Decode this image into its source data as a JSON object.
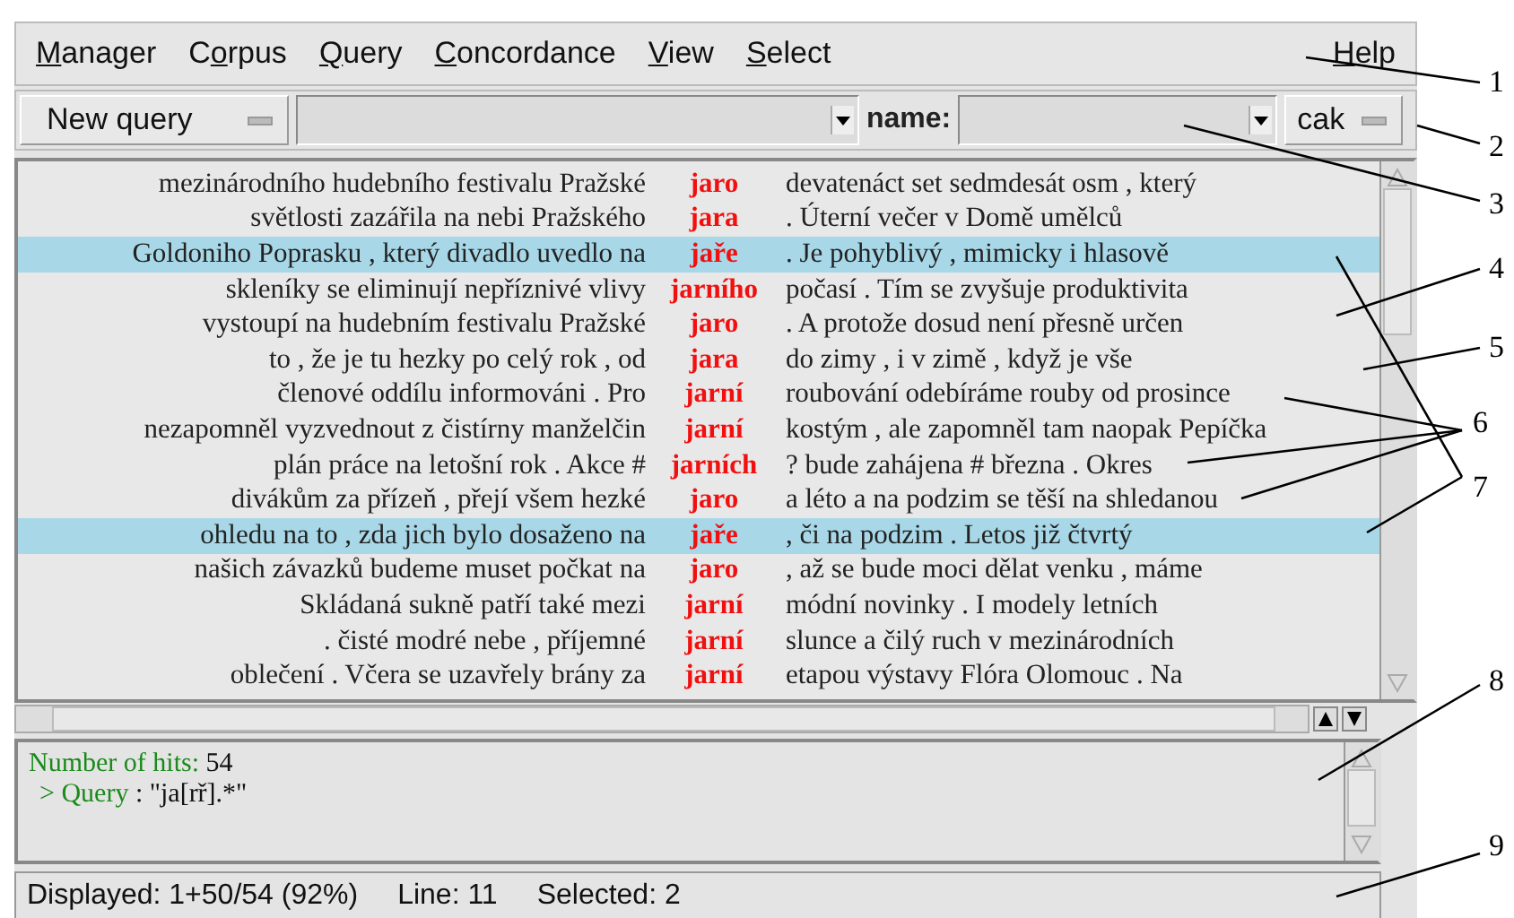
{
  "menu": [
    {
      "key": "M",
      "after": "anager"
    },
    {
      "before": "C",
      "key": "o",
      "after": "rpus"
    },
    {
      "key": "Q",
      "after": "uery"
    },
    {
      "key": "C",
      "after": "oncordance"
    },
    {
      "key": "V",
      "after": "iew"
    },
    {
      "key": "S",
      "after": "elect"
    },
    {
      "key": "H",
      "after": "elp"
    }
  ],
  "toolbar": {
    "query_type": "New query",
    "name_label": "name:",
    "corpus": "cak"
  },
  "rows": [
    {
      "left": "mezinárodního hudebního festivalu Pražské",
      "kwic": "jaro",
      "right": "devatenáct set sedmdesát osm , který",
      "selected": false
    },
    {
      "left": "světlosti zazářila na nebi Pražského",
      "kwic": "jara",
      "right": ".  Úterní večer v Domě umělců",
      "selected": false
    },
    {
      "left": "Goldoniho Poprasku , který divadlo uvedlo na",
      "kwic": "jaře",
      "right": ".  Je pohyblivý , mimicky i hlasově",
      "selected": true
    },
    {
      "left": "skleníky se eliminují nepříznivé vlivy",
      "kwic": "jarního",
      "right": "počasí .  Tím se zvyšuje produktivita",
      "selected": false
    },
    {
      "left": "vystoupí na hudebním festivalu Pražské",
      "kwic": "jaro",
      "right": ".  A protože dosud není přesně určen",
      "selected": false
    },
    {
      "left": "to , že je tu hezky po celý rok , od",
      "kwic": "jara",
      "right": "do zimy , i v zimě , když je vše",
      "selected": false
    },
    {
      "left": "členové oddílu informováni .  Pro",
      "kwic": "jarní",
      "right": "roubování odebíráme rouby od prosince",
      "selected": false
    },
    {
      "left": "nezapomněl vyzvednout z čistírny manželčin",
      "kwic": "jarní",
      "right": "kostým , ale zapomněl tam naopak Pepíčka",
      "selected": false
    },
    {
      "left": "plán práce na letošní rok .  Akce #",
      "kwic": "jarních",
      "right": "? bude zahájena # března .  Okres",
      "selected": false
    },
    {
      "left": "divákům za přízeň , přejí všem hezké",
      "kwic": "jaro",
      "right": "a léto a na podzim se těší na shledanou",
      "selected": false
    },
    {
      "left": "ohledu na to , zda jich bylo dosaženo na",
      "kwic": "jaře",
      "right": ", či na podzim .  Letos již čtvrtý",
      "selected": true
    },
    {
      "left": "našich závazků budeme muset počkat na",
      "kwic": "jaro",
      "right": ", až se bude moci dělat venku , máme",
      "selected": false
    },
    {
      "left": "Skládaná sukně patří také mezi",
      "kwic": "jarní",
      "right": "módní novinky .  I modely letních",
      "selected": false
    },
    {
      "left": ".  čisté modré nebe , příjemné",
      "kwic": "jarní",
      "right": "slunce a čilý ruch v mezinárodních",
      "selected": false
    },
    {
      "left": "oblečení .  Včera se uzavřely brány za",
      "kwic": "jarní",
      "right": "etapou výstavy Flóra Olomouc .  Na",
      "selected": false
    }
  ],
  "info": {
    "hits_label": "Number of hits:",
    "hits": "54",
    "query_label": "> Query",
    "query": ": \"ja[rř].*\""
  },
  "status": {
    "displayed": "Displayed: 1+50/54  (92%)",
    "line": "Line: 11",
    "selected": "Selected: 2"
  },
  "callouts": [
    "1",
    "2",
    "3",
    "4",
    "5",
    "6",
    "7",
    "8",
    "9"
  ]
}
